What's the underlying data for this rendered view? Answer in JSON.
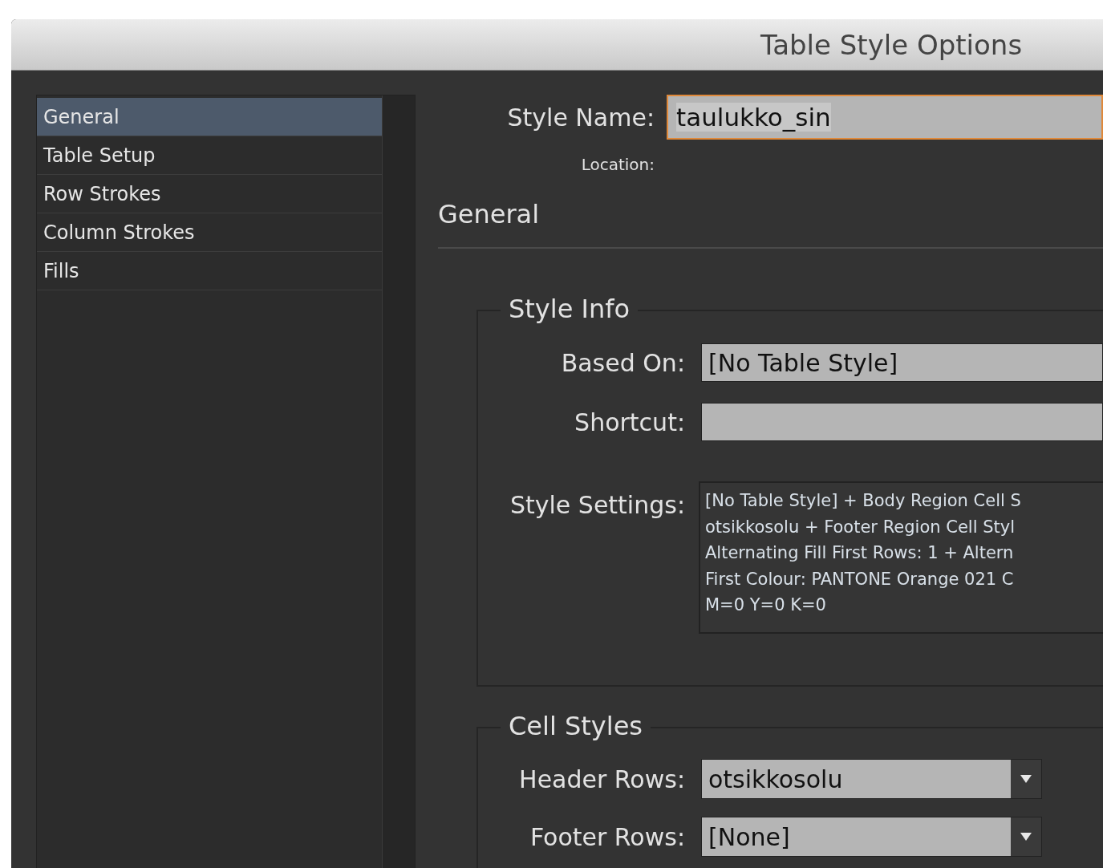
{
  "window": {
    "title": "Table Style Options"
  },
  "sidebar": {
    "items": [
      {
        "label": "General",
        "selected": true
      },
      {
        "label": "Table Setup",
        "selected": false
      },
      {
        "label": "Row Strokes",
        "selected": false
      },
      {
        "label": "Column Strokes",
        "selected": false
      },
      {
        "label": "Fills",
        "selected": false
      }
    ]
  },
  "style_name": {
    "label": "Style Name:",
    "value": "taulukko_sin"
  },
  "location": {
    "label": "Location:"
  },
  "section_title": "General",
  "style_info": {
    "title": "Style Info",
    "based_on": {
      "label": "Based On:",
      "value": "[No Table Style]"
    },
    "shortcut": {
      "label": "Shortcut:"
    },
    "style_settings": {
      "label": "Style Settings:",
      "lines": [
        "[No Table Style] + Body Region Cell S",
        "otsikkosolu + Footer Region Cell Styl",
        "Alternating Fill First Rows: 1 + Altern",
        "First Colour: PANTONE Orange 021 C",
        "M=0 Y=0 K=0"
      ]
    }
  },
  "cell_styles": {
    "title": "Cell Styles",
    "rows": [
      {
        "label": "Header Rows:",
        "value": "otsikkosolu"
      },
      {
        "label": "Footer Rows:",
        "value": "[None]"
      }
    ]
  }
}
